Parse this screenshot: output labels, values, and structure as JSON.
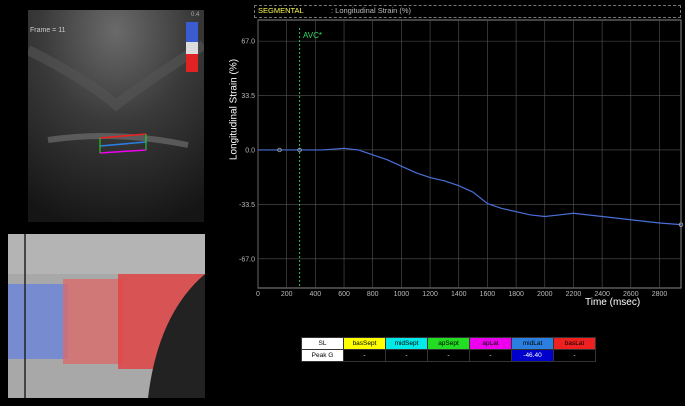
{
  "ultrasound": {
    "frame_label": "Frame = 11",
    "colorbar_top": "0.4"
  },
  "chart_header": {
    "title_main": "SEGMENTAL",
    "title_sub": ": Longitudinal Strain (%)"
  },
  "chart_data": {
    "type": "line",
    "xlabel": "Time (msec)",
    "ylabel": "Longitudinal Strain (%)",
    "x_ticks": [
      0,
      200,
      400,
      600,
      800,
      1000,
      1200,
      1400,
      1600,
      1800,
      2000,
      2200,
      2400,
      2600,
      2800
    ],
    "y_ticks": [
      "67.0",
      "33.5",
      "0.0",
      "-33.5",
      "-67.0"
    ],
    "xlim": [
      0,
      2950
    ],
    "ylim": [
      -85,
      80
    ],
    "annotation": "AVC*",
    "avc_x": 290,
    "series": [
      {
        "color": "#4a6fd8",
        "x": [
          0,
          150,
          290,
          450,
          600,
          700,
          800,
          900,
          1000,
          1100,
          1200,
          1300,
          1400,
          1500,
          1600,
          1700,
          1800,
          1900,
          2000,
          2100,
          2200,
          2400,
          2600,
          2800,
          2950
        ],
        "y": [
          0,
          0,
          0,
          0,
          1,
          0,
          -3,
          -6,
          -10,
          -14,
          -17,
          -19,
          -22,
          -26,
          -33,
          -36,
          -38,
          -40,
          -41,
          -40,
          -39,
          -41,
          -43,
          -45,
          -46
        ]
      }
    ]
  },
  "table": {
    "headers": [
      {
        "label": "SL",
        "color": "#ffffff"
      },
      {
        "label": "basSept",
        "color": "#ffff00"
      },
      {
        "label": "midSept",
        "color": "#00eaea"
      },
      {
        "label": "apSept",
        "color": "#22dd22"
      },
      {
        "label": "apLat",
        "color": "#ee00ee"
      },
      {
        "label": "midLat",
        "color": "#2a7fe0"
      },
      {
        "label": "basLat",
        "color": "#ee2020"
      }
    ],
    "row_label": "Peak G",
    "values": [
      "-",
      "-",
      "-",
      "-",
      "-46.40",
      "-"
    ]
  }
}
